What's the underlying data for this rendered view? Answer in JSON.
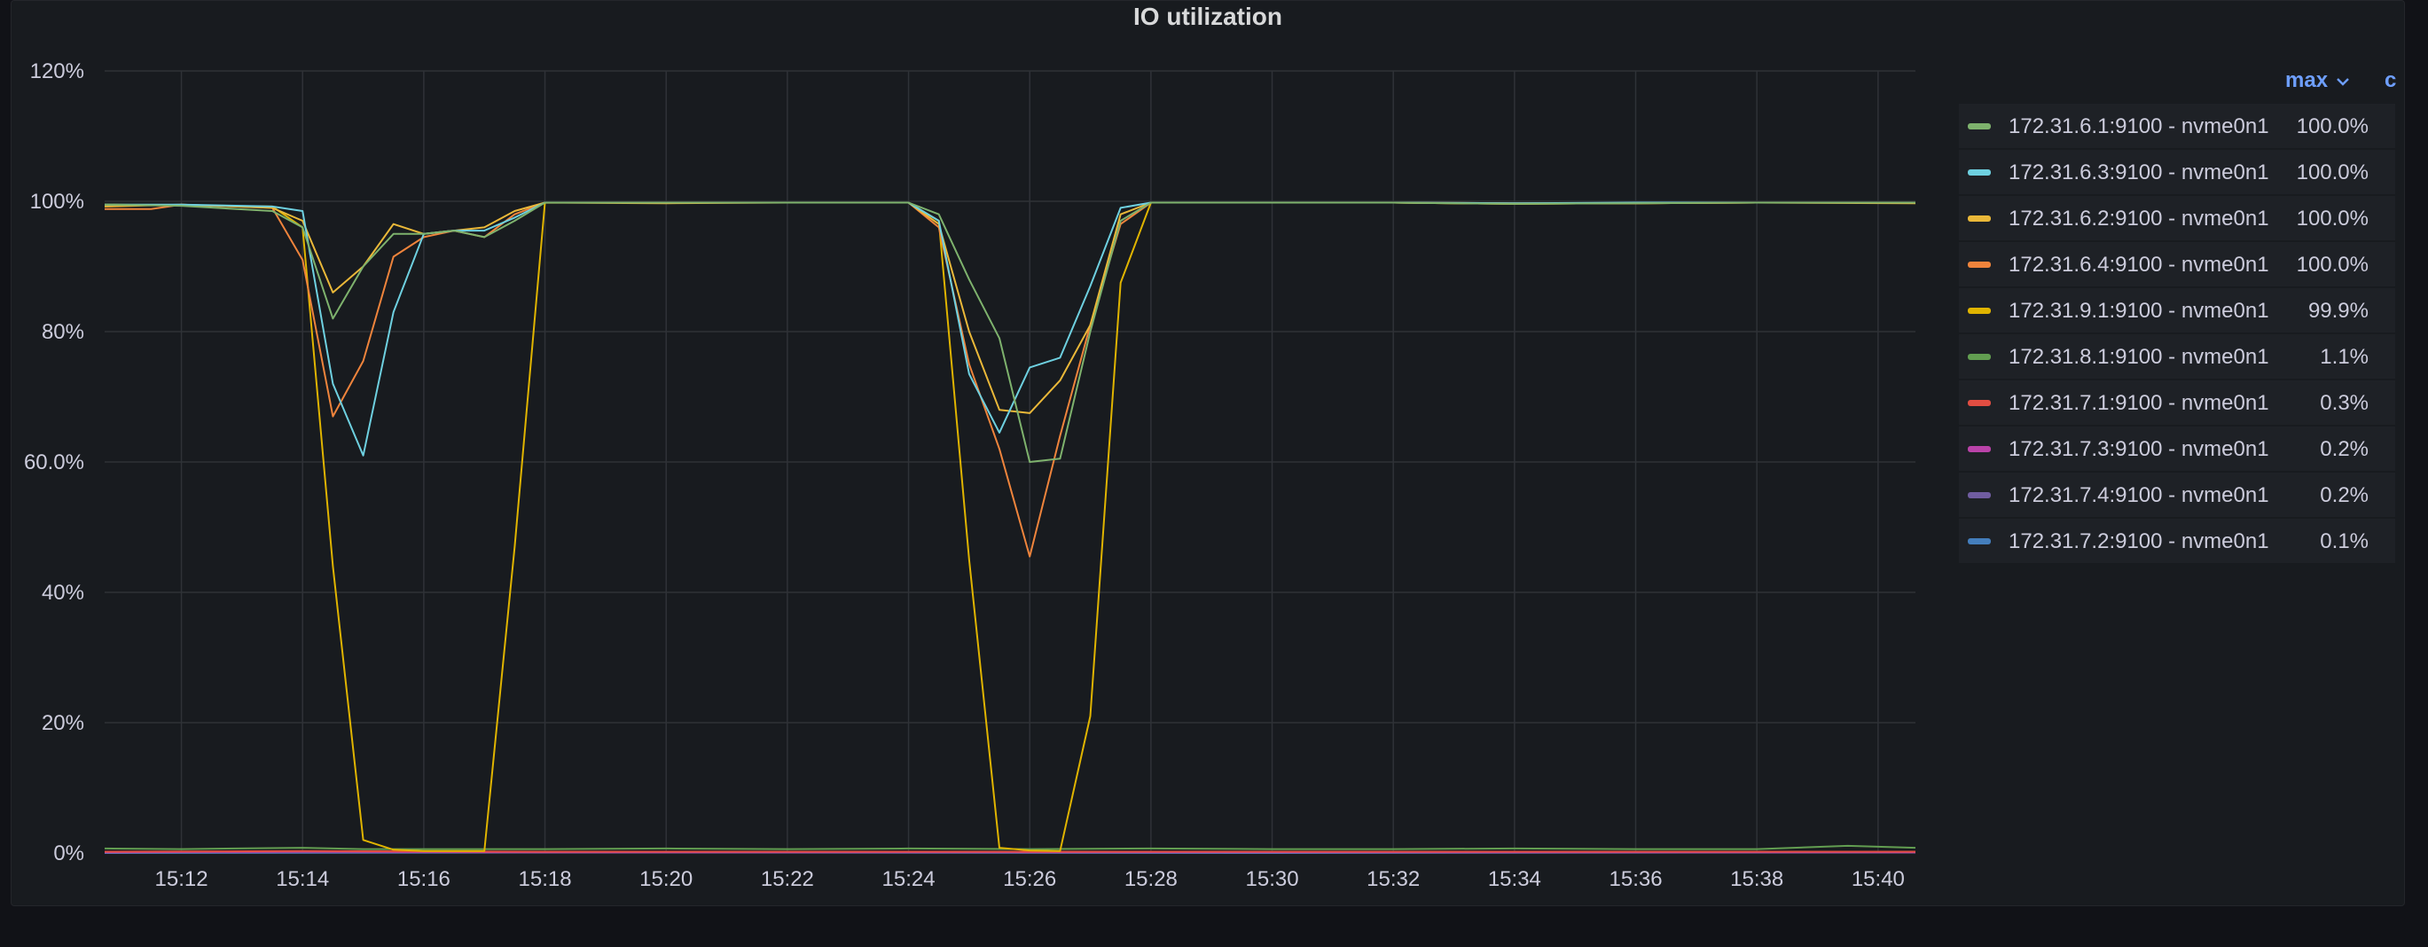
{
  "panel": {
    "title": "IO utilization"
  },
  "legend": {
    "max_header": "max",
    "c_header": "c",
    "rows": [
      {
        "name": "172.31.6.1:9100 - nvme0n1",
        "value": "100.0%",
        "color": "#7eb26d"
      },
      {
        "name": "172.31.6.3:9100 - nvme0n1",
        "value": "100.0%",
        "color": "#6ed0e0"
      },
      {
        "name": "172.31.6.2:9100 - nvme0n1",
        "value": "100.0%",
        "color": "#eab839"
      },
      {
        "name": "172.31.6.4:9100 - nvme0n1",
        "value": "100.0%",
        "color": "#ef843c"
      },
      {
        "name": "172.31.9.1:9100 - nvme0n1",
        "value": "99.9%",
        "color": "#e0b400"
      },
      {
        "name": "172.31.8.1:9100 - nvme0n1",
        "value": "1.1%",
        "color": "#629e51"
      },
      {
        "name": "172.31.7.1:9100 - nvme0n1",
        "value": "0.3%",
        "color": "#e24d42"
      },
      {
        "name": "172.31.7.3:9100 - nvme0n1",
        "value": "0.2%",
        "color": "#ba43a9"
      },
      {
        "name": "172.31.7.4:9100 - nvme0n1",
        "value": "0.2%",
        "color": "#705da0"
      },
      {
        "name": "172.31.7.2:9100 - nvme0n1",
        "value": "0.1%",
        "color": "#447ebc"
      }
    ]
  },
  "chart_data": {
    "type": "line",
    "title": "IO utilization",
    "xlabel": "",
    "ylabel": "",
    "xlim": [
      "15:10:44",
      "15:40:37"
    ],
    "ylim": [
      0,
      120
    ],
    "y_ticks": [
      0,
      20,
      40,
      60,
      80,
      100,
      120
    ],
    "y_tick_labels": [
      "0%",
      "20%",
      "40%",
      "60.0%",
      "80%",
      "100%",
      "120%"
    ],
    "x_ticks": [
      "15:12",
      "15:14",
      "15:16",
      "15:18",
      "15:20",
      "15:22",
      "15:24",
      "15:26",
      "15:28",
      "15:30",
      "15:32",
      "15:34",
      "15:36",
      "15:38",
      "15:40"
    ],
    "grid": true,
    "legend_position": "right",
    "series": [
      {
        "name": "172.31.6.1:9100 - nvme0n1",
        "color": "#7eb26d",
        "points": [
          [
            "15:10:44",
            99.5
          ],
          [
            "15:12:00",
            99.3
          ],
          [
            "15:13:30",
            98.5
          ],
          [
            "15:14:00",
            96
          ],
          [
            "15:14:30",
            82
          ],
          [
            "15:15:00",
            90
          ],
          [
            "15:15:30",
            95
          ],
          [
            "15:16:00",
            95
          ],
          [
            "15:16:30",
            95.5
          ],
          [
            "15:17:00",
            94.5
          ],
          [
            "15:17:30",
            97
          ],
          [
            "15:18:00",
            99.8
          ],
          [
            "15:20:00",
            99.8
          ],
          [
            "15:22:00",
            99.8
          ],
          [
            "15:24:00",
            99.8
          ],
          [
            "15:24:30",
            98
          ],
          [
            "15:25:00",
            88
          ],
          [
            "15:25:30",
            79
          ],
          [
            "15:26:00",
            60
          ],
          [
            "15:26:30",
            60.5
          ],
          [
            "15:27:00",
            80
          ],
          [
            "15:27:30",
            97
          ],
          [
            "15:28:00",
            99.8
          ],
          [
            "15:30:00",
            99.8
          ],
          [
            "15:32:00",
            99.8
          ],
          [
            "15:34:00",
            99.6
          ],
          [
            "15:36:00",
            99.7
          ],
          [
            "15:38:00",
            99.8
          ],
          [
            "15:40:37",
            99.8
          ]
        ]
      },
      {
        "name": "172.31.6.3:9100 - nvme0n1",
        "color": "#6ed0e0",
        "points": [
          [
            "15:10:44",
            99.5
          ],
          [
            "15:12:00",
            99.5
          ],
          [
            "15:13:30",
            99.2
          ],
          [
            "15:14:00",
            98.5
          ],
          [
            "15:14:30",
            72
          ],
          [
            "15:15:00",
            61
          ],
          [
            "15:15:30",
            83
          ],
          [
            "15:16:00",
            95
          ],
          [
            "15:16:30",
            95.5
          ],
          [
            "15:17:00",
            95.5
          ],
          [
            "15:17:30",
            97.5
          ],
          [
            "15:18:00",
            99.8
          ],
          [
            "15:20:00",
            99.8
          ],
          [
            "15:22:00",
            99.8
          ],
          [
            "15:24:00",
            99.8
          ],
          [
            "15:24:30",
            97
          ],
          [
            "15:25:00",
            73.5
          ],
          [
            "15:25:30",
            64.5
          ],
          [
            "15:26:00",
            74.5
          ],
          [
            "15:26:30",
            76
          ],
          [
            "15:27:00",
            87
          ],
          [
            "15:27:30",
            99
          ],
          [
            "15:28:00",
            99.8
          ],
          [
            "15:30:00",
            99.8
          ],
          [
            "15:32:00",
            99.8
          ],
          [
            "15:34:00",
            99.7
          ],
          [
            "15:36:00",
            99.8
          ],
          [
            "15:38:00",
            99.8
          ],
          [
            "15:40:37",
            99.8
          ]
        ]
      },
      {
        "name": "172.31.6.2:9100 - nvme0n1",
        "color": "#eab839",
        "points": [
          [
            "15:10:44",
            99.2
          ],
          [
            "15:12:00",
            99.5
          ],
          [
            "15:13:30",
            99
          ],
          [
            "15:14:00",
            97
          ],
          [
            "15:14:30",
            86
          ],
          [
            "15:15:00",
            90
          ],
          [
            "15:15:30",
            96.5
          ],
          [
            "15:16:00",
            95
          ],
          [
            "15:16:30",
            95.5
          ],
          [
            "15:17:00",
            96
          ],
          [
            "15:17:30",
            98.5
          ],
          [
            "15:18:00",
            99.8
          ],
          [
            "15:20:00",
            99.7
          ],
          [
            "15:22:00",
            99.8
          ],
          [
            "15:24:00",
            99.8
          ],
          [
            "15:24:30",
            96.5
          ],
          [
            "15:25:00",
            80
          ],
          [
            "15:25:30",
            68
          ],
          [
            "15:26:00",
            67.5
          ],
          [
            "15:26:30",
            72.5
          ],
          [
            "15:27:00",
            81
          ],
          [
            "15:27:30",
            98
          ],
          [
            "15:28:00",
            99.8
          ],
          [
            "15:30:00",
            99.8
          ],
          [
            "15:32:00",
            99.8
          ],
          [
            "15:34:00",
            99.6
          ],
          [
            "15:36:00",
            99.7
          ],
          [
            "15:38:00",
            99.8
          ],
          [
            "15:40:37",
            99.7
          ]
        ]
      },
      {
        "name": "172.31.6.4:9100 - nvme0n1",
        "color": "#ef843c",
        "points": [
          [
            "15:10:44",
            98.8
          ],
          [
            "15:11:30",
            98.8
          ],
          [
            "15:12:00",
            99.5
          ],
          [
            "15:13:30",
            99
          ],
          [
            "15:14:00",
            91
          ],
          [
            "15:14:30",
            67
          ],
          [
            "15:15:00",
            75.5
          ],
          [
            "15:15:30",
            91.5
          ],
          [
            "15:16:00",
            94.5
          ],
          [
            "15:16:30",
            95.5
          ],
          [
            "15:17:00",
            94.5
          ],
          [
            "15:17:30",
            98
          ],
          [
            "15:18:00",
            99.8
          ],
          [
            "15:20:00",
            99.8
          ],
          [
            "15:22:00",
            99.8
          ],
          [
            "15:24:00",
            99.8
          ],
          [
            "15:24:30",
            96
          ],
          [
            "15:25:00",
            75
          ],
          [
            "15:25:30",
            62
          ],
          [
            "15:26:00",
            45.5
          ],
          [
            "15:26:30",
            64
          ],
          [
            "15:27:00",
            81
          ],
          [
            "15:27:30",
            96.5
          ],
          [
            "15:28:00",
            99.8
          ],
          [
            "15:30:00",
            99.8
          ],
          [
            "15:32:00",
            99.8
          ],
          [
            "15:34:00",
            99.7
          ],
          [
            "15:36:00",
            99.7
          ],
          [
            "15:38:00",
            99.8
          ],
          [
            "15:40:37",
            99.8
          ]
        ]
      },
      {
        "name": "172.31.9.1:9100 - nvme0n1",
        "color": "#e0b400",
        "points": [
          [
            "15:10:44",
            99.5
          ],
          [
            "15:13:30",
            99.2
          ],
          [
            "15:14:00",
            96
          ],
          [
            "15:14:30",
            44
          ],
          [
            "15:15:00",
            2
          ],
          [
            "15:15:30",
            0.5
          ],
          [
            "15:16:00",
            0.3
          ],
          [
            "15:17:00",
            0.3
          ],
          [
            "15:17:30",
            47
          ],
          [
            "15:18:00",
            99.8
          ],
          [
            "15:20:00",
            99.8
          ],
          [
            "15:22:00",
            99.8
          ],
          [
            "15:24:00",
            99.8
          ],
          [
            "15:24:30",
            97
          ],
          [
            "15:25:00",
            45
          ],
          [
            "15:25:30",
            0.8
          ],
          [
            "15:26:00",
            0.4
          ],
          [
            "15:26:30",
            0.3
          ],
          [
            "15:27:00",
            21
          ],
          [
            "15:27:30",
            87.5
          ],
          [
            "15:28:00",
            99.8
          ],
          [
            "15:30:00",
            99.8
          ],
          [
            "15:32:00",
            99.8
          ],
          [
            "15:34:00",
            99.6
          ],
          [
            "15:36:00",
            99.7
          ],
          [
            "15:38:00",
            99.8
          ],
          [
            "15:40:37",
            99.8
          ]
        ]
      },
      {
        "name": "172.31.8.1:9100 - nvme0n1",
        "color": "#629e51",
        "points": [
          [
            "15:10:44",
            0.7
          ],
          [
            "15:12:00",
            0.6
          ],
          [
            "15:14:00",
            0.8
          ],
          [
            "15:15:00",
            0.6
          ],
          [
            "15:16:00",
            0.6
          ],
          [
            "15:18:00",
            0.6
          ],
          [
            "15:20:00",
            0.7
          ],
          [
            "15:22:00",
            0.6
          ],
          [
            "15:24:00",
            0.7
          ],
          [
            "15:26:00",
            0.6
          ],
          [
            "15:28:00",
            0.7
          ],
          [
            "15:30:00",
            0.6
          ],
          [
            "15:32:00",
            0.6
          ],
          [
            "15:34:00",
            0.7
          ],
          [
            "15:36:00",
            0.6
          ],
          [
            "15:38:00",
            0.6
          ],
          [
            "15:39:30",
            1.1
          ],
          [
            "15:40:37",
            0.8
          ]
        ]
      },
      {
        "name": "172.31.7.1:9100 - nvme0n1",
        "color": "#e24d42",
        "points": [
          [
            "15:10:44",
            0.2
          ],
          [
            "15:14:00",
            0.3
          ],
          [
            "15:18:00",
            0.2
          ],
          [
            "15:24:00",
            0.2
          ],
          [
            "15:30:00",
            0.2
          ],
          [
            "15:36:00",
            0.2
          ],
          [
            "15:40:37",
            0.2
          ]
        ]
      },
      {
        "name": "172.31.7.3:9100 - nvme0n1",
        "color": "#ba43a9",
        "points": [
          [
            "15:10:44",
            0.1
          ],
          [
            "15:14:00",
            0.2
          ],
          [
            "15:18:00",
            0.1
          ],
          [
            "15:24:00",
            0.1
          ],
          [
            "15:30:00",
            0.1
          ],
          [
            "15:36:00",
            0.1
          ],
          [
            "15:40:37",
            0.1
          ]
        ]
      },
      {
        "name": "172.31.7.4:9100 - nvme0n1",
        "color": "#705da0",
        "points": [
          [
            "15:10:44",
            0.1
          ],
          [
            "15:16:00",
            0.1
          ],
          [
            "15:22:00",
            0.1
          ],
          [
            "15:28:00",
            0.2
          ],
          [
            "15:34:00",
            0.1
          ],
          [
            "15:40:37",
            0.1
          ]
        ]
      },
      {
        "name": "172.31.7.2:9100 - nvme0n1",
        "color": "#447ebc",
        "points": [
          [
            "15:10:44",
            0.0
          ],
          [
            "15:20:00",
            0.1
          ],
          [
            "15:30:00",
            0.0
          ],
          [
            "15:40:37",
            0.1
          ]
        ]
      }
    ]
  }
}
